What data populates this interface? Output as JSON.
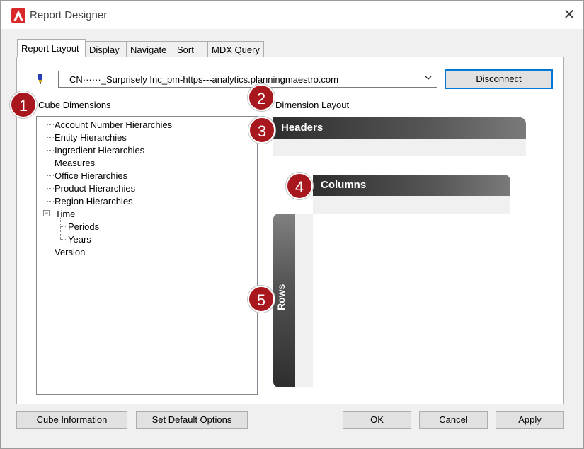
{
  "window": {
    "title": "Report Designer",
    "close_glyph": "✕"
  },
  "tabs": [
    {
      "label": "Report Layout",
      "active": true
    },
    {
      "label": "Display",
      "active": false
    },
    {
      "label": "Navigate",
      "active": false
    },
    {
      "label": "Sort",
      "active": false
    },
    {
      "label": "MDX Query",
      "active": false
    }
  ],
  "connection": {
    "selected": "CN······_Surprisely Inc_pm-https---analytics.planningmaestro.com",
    "disconnect_label": "Disconnect"
  },
  "cube_dimensions": {
    "label": "Cube Dimensions",
    "items": [
      "Account Number Hierarchies",
      "Entity Hierarchies",
      "Ingredient Hierarchies",
      "Measures",
      "Office Hierarchies",
      "Product Hierarchies",
      "Region Hierarchies",
      "Time",
      "Periods",
      "Years",
      "Version"
    ],
    "expander_glyph": "−"
  },
  "dimension_layout": {
    "label": "Dimension Layout",
    "headers_label": "Headers",
    "columns_label": "Columns",
    "rows_label": "Rows"
  },
  "badges": [
    "1",
    "2",
    "3",
    "4",
    "5"
  ],
  "buttons": {
    "cube_information": "Cube Information",
    "set_default_options": "Set Default Options",
    "ok": "OK",
    "cancel": "Cancel",
    "apply": "Apply"
  },
  "colors": {
    "badge": "#a8161e",
    "accent_border": "#0078d7",
    "app_icon": "#d9282a"
  }
}
